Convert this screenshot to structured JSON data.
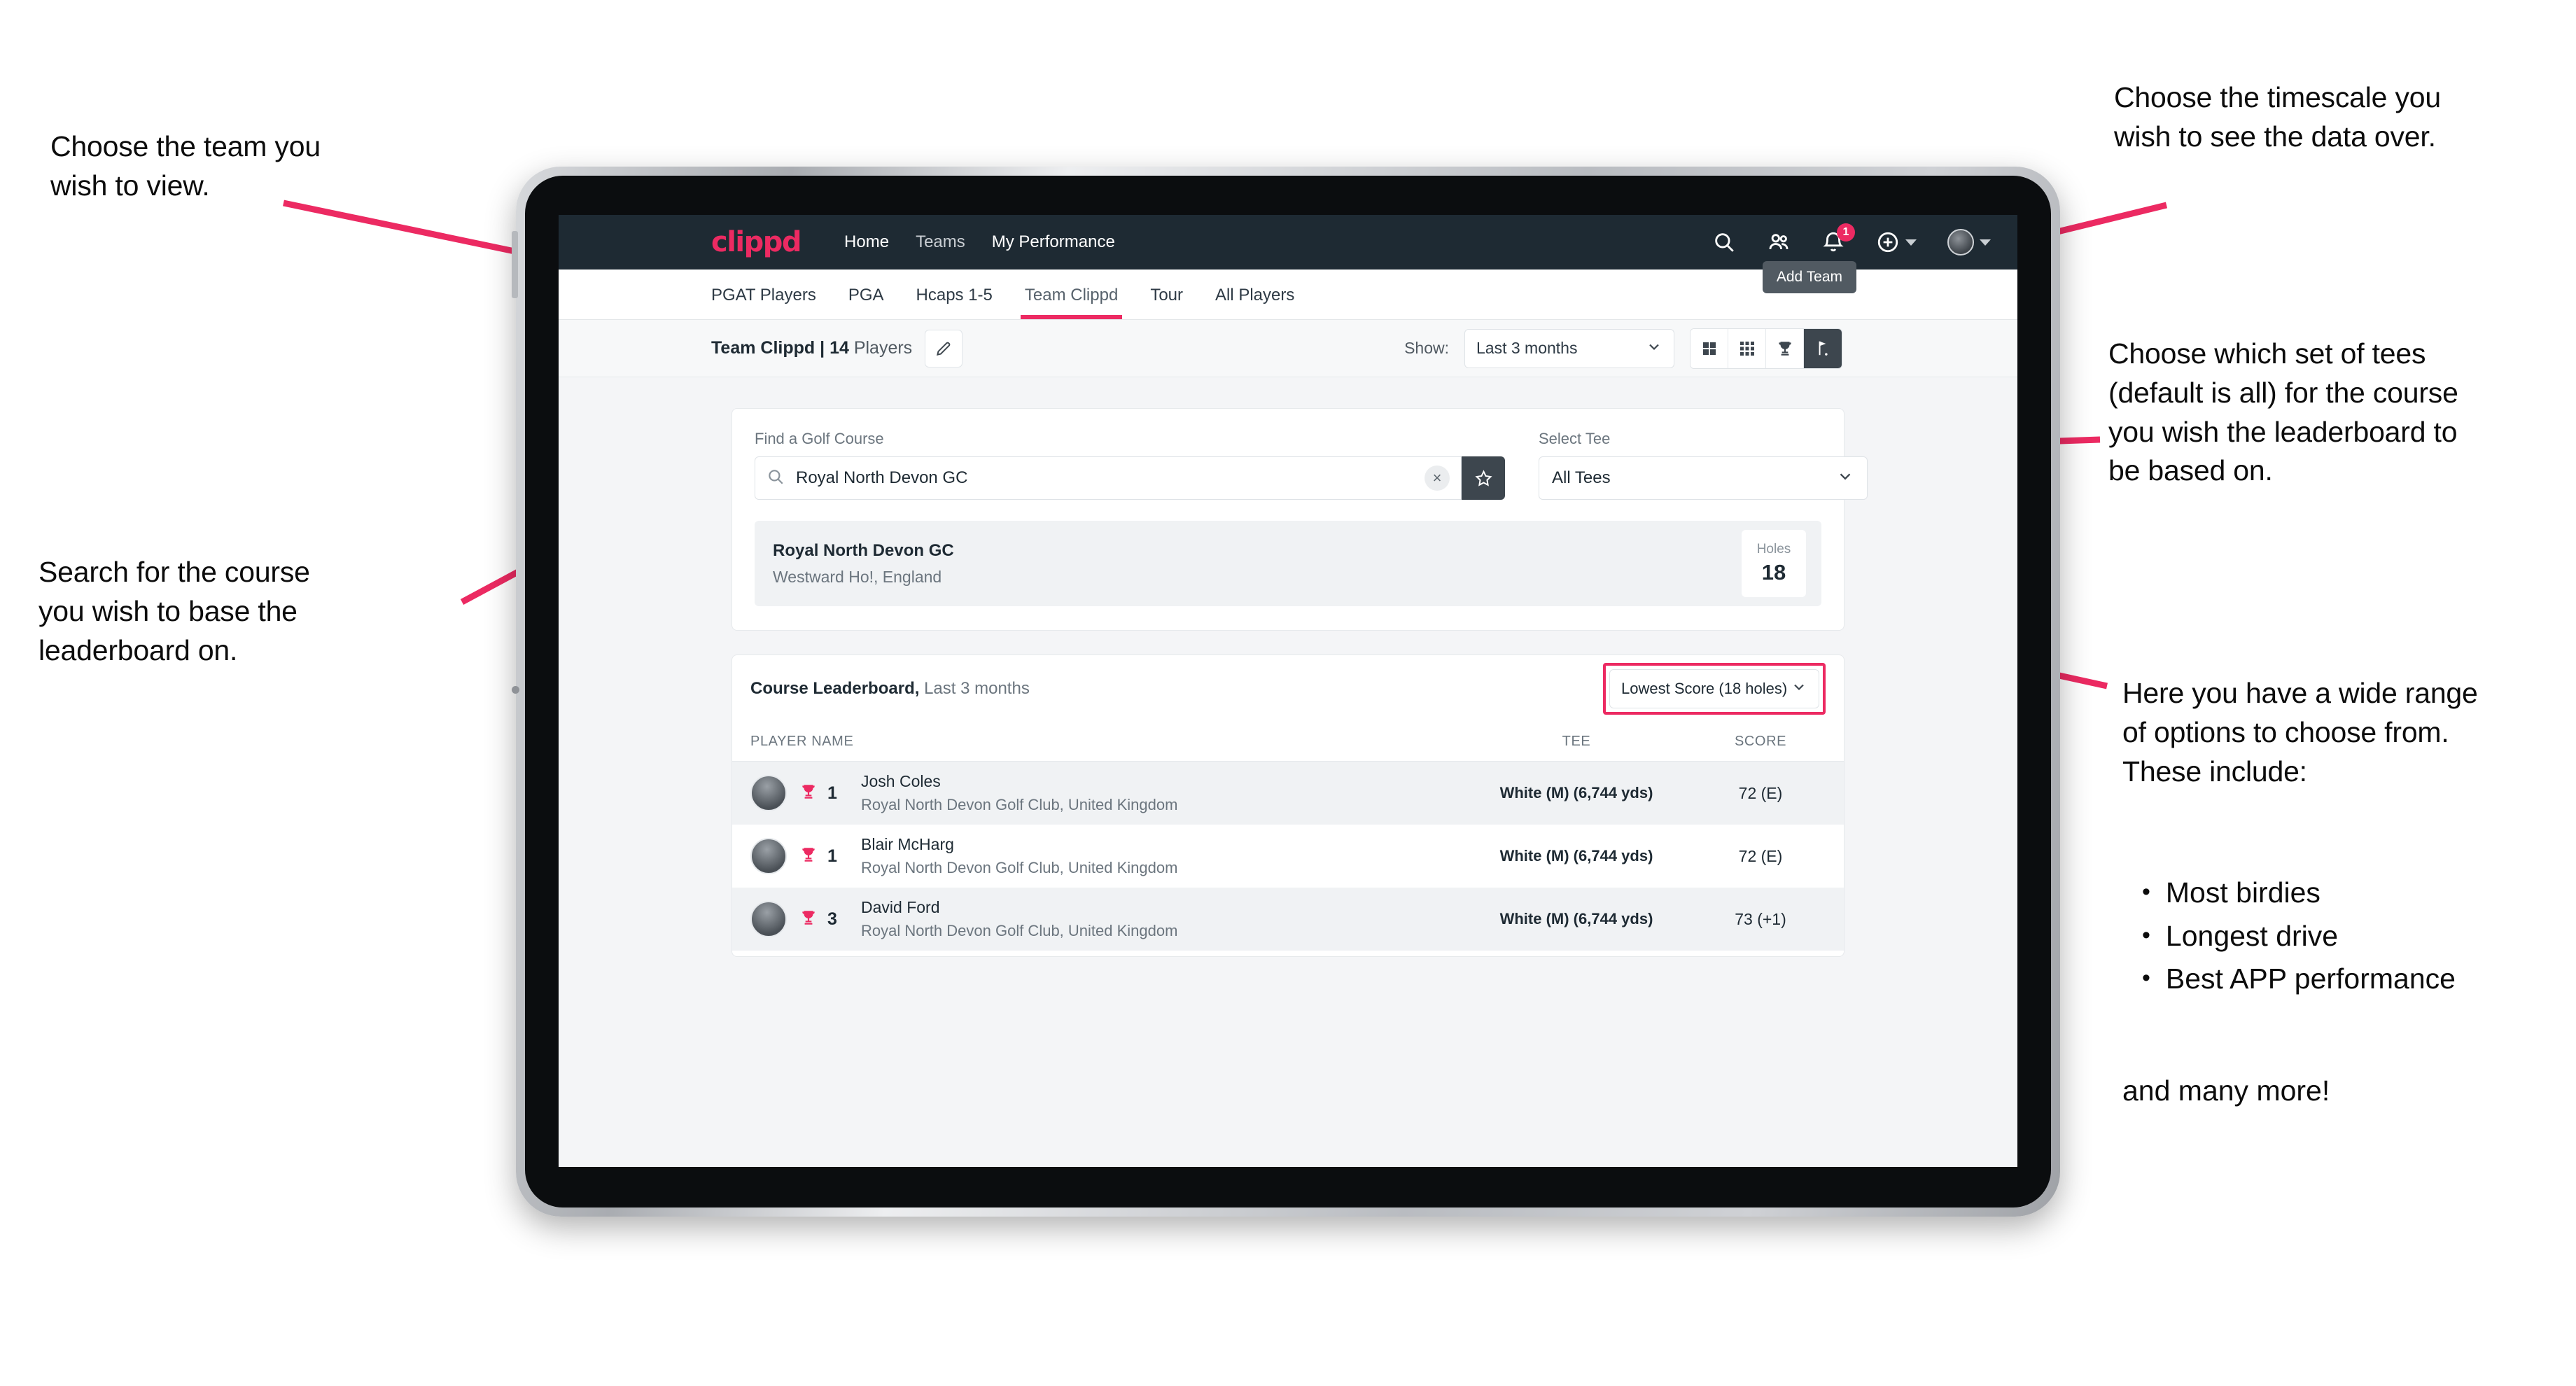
{
  "annotations": {
    "left_top": "Choose the team you\nwish to view.",
    "left_bottom": "Search for the course\nyou wish to base the\nleaderboard on.",
    "right_top": "Choose the timescale you\nwish to see the data over.",
    "right_tees": "Choose which set of tees\n(default is all) for the course\nyou wish the leaderboard to\nbe based on.",
    "right_options_intro": "Here you have a wide range\nof options to choose from.\nThese include:",
    "right_options_list": [
      "Most birdies",
      "Longest drive",
      "Best APP performance"
    ],
    "right_options_tail": "and many more!"
  },
  "navbar": {
    "logo": "clippd",
    "links": [
      {
        "label": "Home",
        "active": true
      },
      {
        "label": "Teams",
        "active": false
      },
      {
        "label": "My Performance",
        "active": true
      }
    ],
    "icons": [
      "search-icon",
      "people-icon",
      "notifications-icon",
      "add-icon",
      "avatar"
    ],
    "notification_count": "1"
  },
  "tabs": {
    "items": [
      {
        "label": "PGAT Players",
        "active": false
      },
      {
        "label": "PGA",
        "active": false
      },
      {
        "label": "Hcaps 1-5",
        "active": false
      },
      {
        "label": "Team Clippd",
        "active": true
      },
      {
        "label": "Tour",
        "active": false
      },
      {
        "label": "All Players",
        "active": false
      }
    ],
    "tooltip": "Add Team"
  },
  "subbar": {
    "team_name": "Team Clippd",
    "separator": " | ",
    "player_count": "14",
    "players_word": " Players",
    "edit_icon": "pencil-icon",
    "show_label": "Show:",
    "timescale_value": "Last 3 months",
    "view_toggles": [
      {
        "icon": "grid-2x2-icon",
        "active": false
      },
      {
        "icon": "grid-3x3-icon",
        "active": false
      },
      {
        "icon": "trophy-icon",
        "active": false
      },
      {
        "icon": "golf-flag-icon",
        "active": true
      }
    ]
  },
  "search_card": {
    "course_label": "Find a Golf Course",
    "course_value": "Royal North Devon GC",
    "course_placeholder": "Find a Golf Course",
    "clear_label": "×",
    "favourite_icon": "star-icon",
    "tee_label": "Select Tee",
    "tee_value": "All Tees"
  },
  "course_result": {
    "name": "Royal North Devon GC",
    "location": "Westward Ho!, England",
    "holes_label": "Holes",
    "holes_value": "18"
  },
  "leaderboard": {
    "title": "Course Leaderboard,",
    "subtitle": " Last 3 months",
    "metric_value": "Lowest Score (18 holes)",
    "columns": [
      "PLAYER NAME",
      "TEE",
      "SCORE"
    ],
    "rows": [
      {
        "rank": "1",
        "name": "Josh Coles",
        "club": "Royal North Devon Golf Club, United Kingdom",
        "tee": "White (M) (6,744 yds)",
        "score": "72 (E)"
      },
      {
        "rank": "1",
        "name": "Blair McHarg",
        "club": "Royal North Devon Golf Club, United Kingdom",
        "tee": "White (M) (6,744 yds)",
        "score": "72 (E)"
      },
      {
        "rank": "3",
        "name": "David Ford",
        "club": "Royal North Devon Golf Club, United Kingdom",
        "tee": "White (M) (6,744 yds)",
        "score": "73 (+1)"
      }
    ]
  },
  "colors": {
    "accent": "#ec2a62",
    "navbar_bg": "#1e2a33",
    "dark_button": "#3d464e"
  }
}
